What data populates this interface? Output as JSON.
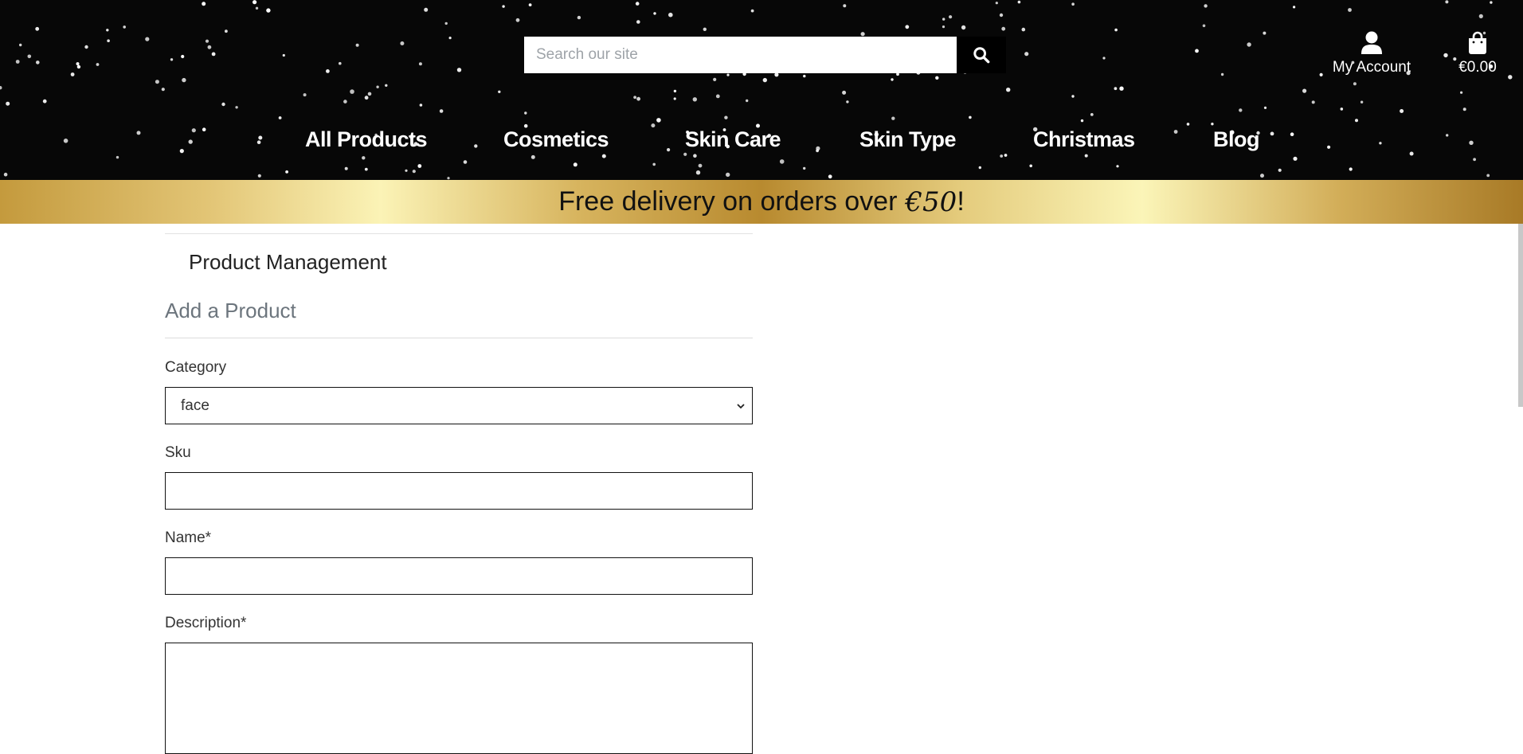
{
  "header": {
    "search": {
      "placeholder": "Search our site",
      "button_icon": "search-icon"
    },
    "account": {
      "label": "My Account",
      "icon": "user-icon"
    },
    "cart": {
      "label": "€0.00",
      "icon": "shopping-bag-icon"
    },
    "nav": [
      {
        "label": "All Products"
      },
      {
        "label": "Cosmetics"
      },
      {
        "label": "Skin Care"
      },
      {
        "label": "Skin Type"
      },
      {
        "label": "Christmas"
      },
      {
        "label": "Blog"
      }
    ]
  },
  "banner": {
    "text": "Free delivery on orders over",
    "amount": "€50",
    "suffix": "!"
  },
  "page": {
    "title": "Product Management",
    "subtitle": "Add a Product"
  },
  "form": {
    "category": {
      "label": "Category",
      "value": "face"
    },
    "sku": {
      "label": "Sku",
      "value": ""
    },
    "name": {
      "label": "Name*",
      "value": ""
    },
    "description": {
      "label": "Description*",
      "value": ""
    }
  },
  "colors": {
    "header_bg": "#070707",
    "banner_gold": "#d4b05a",
    "muted_text": "#6c757d"
  }
}
